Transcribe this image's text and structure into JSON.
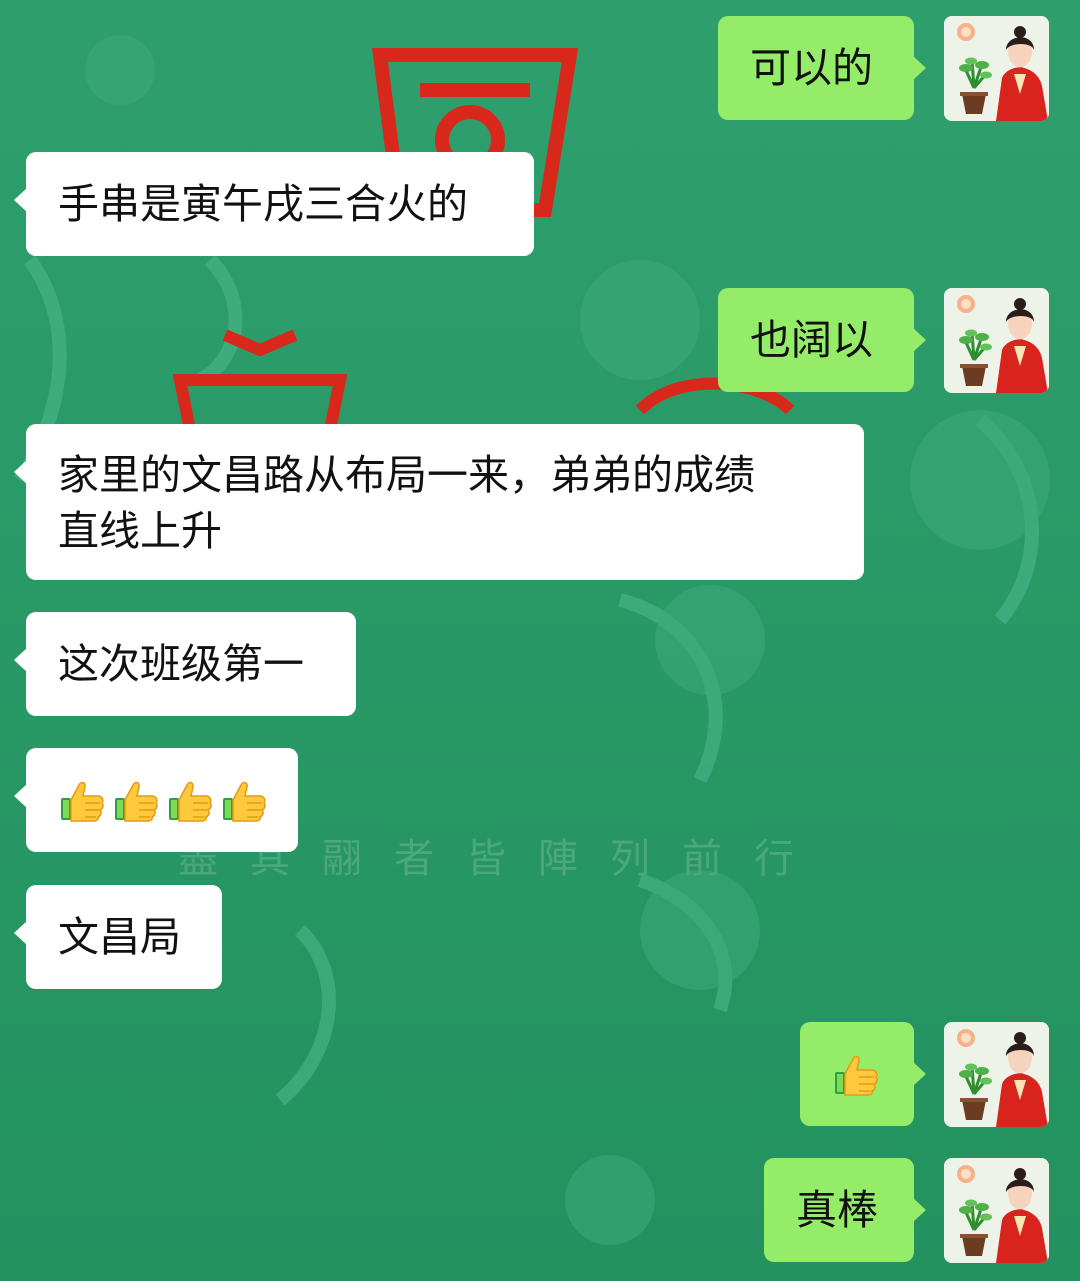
{
  "chat": {
    "messages": [
      {
        "side": "out",
        "text": "可以的"
      },
      {
        "side": "in",
        "text": "手串是寅午戌三合火的"
      },
      {
        "side": "out",
        "text": "也阔以"
      },
      {
        "side": "in",
        "text": "家里的文昌路从布局一来，弟弟的成绩\n直线上升"
      },
      {
        "side": "in",
        "text": "这次班级第一"
      },
      {
        "side": "in",
        "emoji": [
          "thumbs-up-icon",
          "thumbs-up-icon",
          "thumbs-up-icon",
          "thumbs-up-icon"
        ]
      },
      {
        "side": "in",
        "text": "文昌局"
      },
      {
        "side": "out",
        "emoji": [
          "thumbs-up-icon"
        ]
      },
      {
        "side": "out",
        "text": "真棒"
      }
    ]
  },
  "background": {
    "caption": "盡其翮者皆陣列前行"
  },
  "colors": {
    "chat_background": "#2a9a6a",
    "incoming_bubble": "#ffffff",
    "outgoing_bubble": "#95ec69",
    "background_seal_red": "#d8281c"
  }
}
